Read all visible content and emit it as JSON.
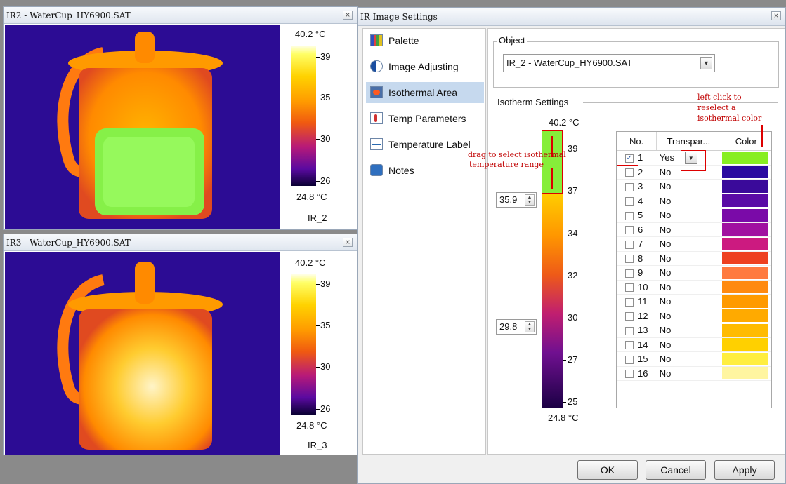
{
  "ir2": {
    "title": "IR2 - WaterCup_HY6900.SAT",
    "close": "×",
    "max_temp": "40.2 °C",
    "min_temp": "24.8 °C",
    "ticks": [
      "39",
      "35",
      "30",
      "26"
    ],
    "image_label": "IR_2"
  },
  "ir3": {
    "title": "IR3 - WaterCup_HY6900.SAT",
    "close": "×",
    "max_temp": "40.2 °C",
    "min_temp": "24.8 °C",
    "ticks": [
      "39",
      "35",
      "30",
      "26"
    ],
    "image_label": "IR_3"
  },
  "dialog": {
    "title": "IR Image Settings",
    "close": "×",
    "nav": [
      {
        "label": "Palette"
      },
      {
        "label": "Image Adjusting"
      },
      {
        "label": "Isothermal Area"
      },
      {
        "label": "Temp Parameters"
      },
      {
        "label": "Temperature Label"
      },
      {
        "label": "Notes"
      }
    ],
    "object_group_label": "Object",
    "object_value": "IR_2 - WaterCup_HY6900.SAT",
    "isotherm_group_label": "Isotherm Settings",
    "bar_max": "40.2 °C",
    "bar_min": "24.8 °C",
    "bar_ticks": [
      "39",
      "37",
      "34",
      "32",
      "30",
      "27",
      "25"
    ],
    "upper_value": "35.9",
    "lower_value": "29.8",
    "table": {
      "headers": [
        "No.",
        "Transpar...",
        "Color"
      ],
      "rows": [
        {
          "no": "1",
          "val": "Yes",
          "checked": true,
          "color": "#88ee22"
        },
        {
          "no": "2",
          "val": "No",
          "color": "#2a0aa0"
        },
        {
          "no": "3",
          "val": "No",
          "color": "#3a0a9a"
        },
        {
          "no": "4",
          "val": "No",
          "color": "#5a0aa6"
        },
        {
          "no": "5",
          "val": "No",
          "color": "#7a0aa8"
        },
        {
          "no": "6",
          "val": "No",
          "color": "#a010a0"
        },
        {
          "no": "7",
          "val": "No",
          "color": "#cc1a80"
        },
        {
          "no": "8",
          "val": "No",
          "color": "#ee4020"
        },
        {
          "no": "9",
          "val": "No",
          "color": "#ff7a40"
        },
        {
          "no": "10",
          "val": "No",
          "color": "#ff8a10"
        },
        {
          "no": "11",
          "val": "No",
          "color": "#ff9a00"
        },
        {
          "no": "12",
          "val": "No",
          "color": "#ffaa00"
        },
        {
          "no": "13",
          "val": "No",
          "color": "#ffbb00"
        },
        {
          "no": "14",
          "val": "No",
          "color": "#ffd000"
        },
        {
          "no": "15",
          "val": "No",
          "color": "#ffee40"
        },
        {
          "no": "16",
          "val": "No",
          "color": "#fff5a0"
        }
      ]
    },
    "buttons": {
      "ok": "OK",
      "cancel": "Cancel",
      "apply": "Apply"
    },
    "annotations": {
      "drag_line1": "drag to select isothermal",
      "drag_line2": "temperature range",
      "click_line1": "left click to",
      "click_line2": "reselect a",
      "click_line3": "isothermal color"
    }
  }
}
